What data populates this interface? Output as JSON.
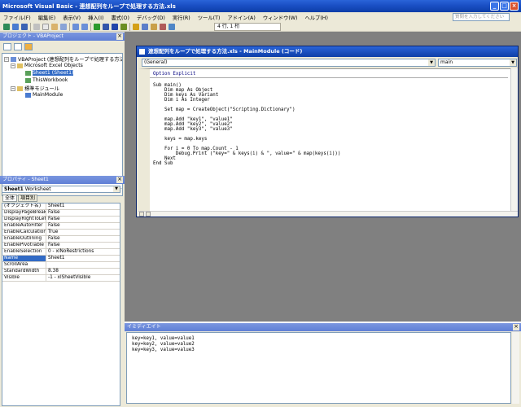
{
  "window": {
    "title": "Microsoft Visual Basic - 連想配列をループで処理する方法.xls",
    "min": "_",
    "max": "□",
    "close": "×"
  },
  "menu": [
    "ファイル(F)",
    "編集(E)",
    "表示(V)",
    "挿入(I)",
    "書式(O)",
    "デバッグ(D)",
    "実行(R)",
    "ツール(T)",
    "アドイン(A)",
    "ウィンドウ(W)",
    "ヘルプ(H)"
  ],
  "help_search": {
    "placeholder": "質問を入力してください"
  },
  "toolbar": {
    "cursor_position": "4 行, 1 桁"
  },
  "project": {
    "title": "プロジェクト - VBAProject",
    "close": "×",
    "tree": [
      {
        "label": "VBAProject (連想配列をループで処理する方法",
        "level": 0,
        "expander": "−"
      },
      {
        "label": "Microsoft Excel Objects",
        "level": 1,
        "expander": "−"
      },
      {
        "label": "Sheet1 (Sheet1)",
        "level": 2,
        "expander": "",
        "selected": true
      },
      {
        "label": "ThisWorkbook",
        "level": 2,
        "expander": ""
      },
      {
        "label": "標準モジュール",
        "level": 1,
        "expander": "−"
      },
      {
        "label": "MainModule",
        "level": 2,
        "expander": ""
      }
    ]
  },
  "properties": {
    "title": "プロパティ - Sheet1",
    "close": "×",
    "object_name": "Sheet1",
    "object_type": "Worksheet",
    "tabs": [
      "全体",
      "項目別"
    ],
    "rows": [
      {
        "name": "(オブジェクト名)",
        "value": "Sheet1"
      },
      {
        "name": "DisplayPageBreaks",
        "value": "False"
      },
      {
        "name": "DisplayRightToLeft",
        "value": "False"
      },
      {
        "name": "EnableAutoFilter",
        "value": "False"
      },
      {
        "name": "EnableCalculation",
        "value": "True"
      },
      {
        "name": "EnableOutlining",
        "value": "False"
      },
      {
        "name": "EnablePivotTable",
        "value": "False"
      },
      {
        "name": "EnableSelection",
        "value": "0 - xlNoRestrictions"
      },
      {
        "name": "Name",
        "value": "Sheet1",
        "selected": true
      },
      {
        "name": "ScrollArea",
        "value": ""
      },
      {
        "name": "StandardWidth",
        "value": "8.38"
      },
      {
        "name": "Visible",
        "value": "-1 - xlSheetVisible"
      }
    ]
  },
  "code_window": {
    "title": "連想配列をループで処理する方法.xls - MainModule (コード)",
    "object_combo": "(General)",
    "proc_combo": "main",
    "lines": [
      "Option Explicit",
      "",
      "Sub main()",
      "    Dim map As Object",
      "    Dim keys As Variant",
      "    Dim i As Integer",
      "",
      "    Set map = CreateObject(\"Scripting.Dictionary\")",
      "",
      "    map.Add \"key1\", \"value1\"",
      "    map.Add \"key2\", \"value2\"",
      "    map.Add \"key3\", \"value3\"",
      "",
      "    keys = map.keys",
      "",
      "    For i = 0 To map.Count - 1",
      "        Debug.Print (\"key=\" & keys(i) & \", value=\" & map(keys(i)))",
      "    Next",
      "End Sub"
    ]
  },
  "immediate": {
    "title": "イミディエイト",
    "close": "×",
    "lines": [
      "key=key1, value=value1",
      "key=key2, value=value2",
      "key=key3, value=value3"
    ]
  }
}
